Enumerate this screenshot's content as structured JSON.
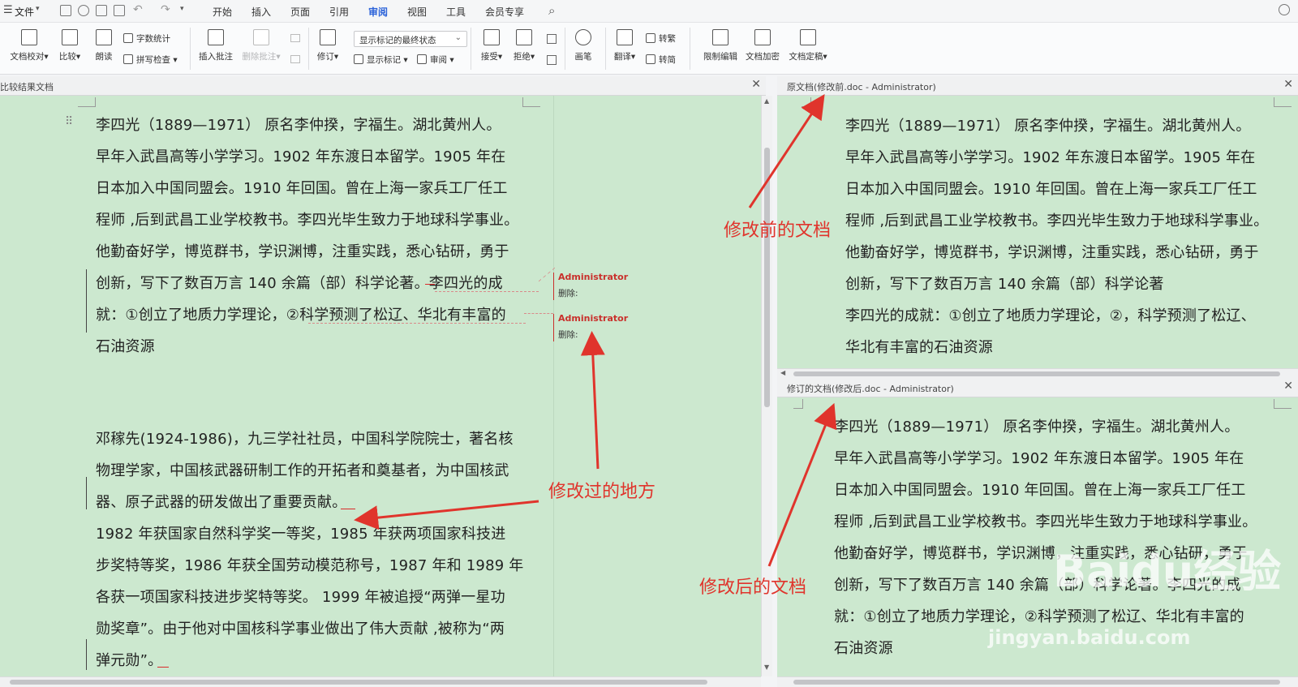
{
  "topbar": {
    "menu_icon": "hamburger-icon",
    "file_label": "文件",
    "tabs": [
      {
        "label": "开始",
        "active": false
      },
      {
        "label": "插入",
        "active": false
      },
      {
        "label": "页面",
        "active": false
      },
      {
        "label": "引用",
        "active": false
      },
      {
        "label": "审阅",
        "active": true
      },
      {
        "label": "视图",
        "active": false
      },
      {
        "label": "工具",
        "active": false
      },
      {
        "label": "会员专享",
        "active": false
      }
    ]
  },
  "ribbon": {
    "doc_proofread": "文档校对",
    "compare": "比较",
    "read_aloud": "朗读",
    "word_count": "字数统计",
    "spell_check": "拼写检查",
    "insert_comment": "插入批注",
    "delete_comment": "删除批注",
    "track_changes": "修订",
    "show_markup_state": "显示标记的最终状态",
    "show_markup": "显示标记",
    "review": "审阅",
    "accept": "接受",
    "reject": "拒绝",
    "pen": "画笔",
    "translate": "翻译",
    "to_traditional": "转繁",
    "to_simplified": "转简",
    "restrict_edit": "限制编辑",
    "doc_encrypt": "文档加密",
    "doc_finalize": "文档定稿"
  },
  "compare_pane": {
    "title": "比较结果文档",
    "paragraph1": [
      "李四光（1889—1971） 原名李仲揆，字福生。湖北黄州人。",
      "早年入武昌高等小学学习。1902 年东渡日本留学。1905 年在",
      "日本加入中国同盟会。1910 年回国。曾在上海一家兵工厂任工",
      "程师 ,后到武昌工业学校教书。李四光毕生致力于地球科学事业。",
      "他勤奋好学，博览群书，学识渊博，注重实践，悉心钻研，勇于",
      "创新，写下了数百万言 140 余篇（部）科学论著。李四光的成",
      "就：①创立了地质力学理论，②科学预测了松辽、华北有丰富的",
      "石油资源"
    ],
    "paragraph2": [
      "邓稼先(1924-1986)，九三学社社员，中国科学院院士，著名核",
      "物理学家，中国核武器研制工作的开拓者和奠基者，为中国核武",
      "器、原子武器的研发做出了重要贡献。",
      "1982 年获国家自然科学奖一等奖，1985 年获两项国家科技进",
      "步奖特等奖，1986 年获全国劳动模范称号，1987 年和 1989 年",
      "各获一项国家科技进步奖特等奖。 1999 年被追授“两弹一星功",
      "勋奖章”。由于他对中国核科学事业做出了伟大贡献 ,被称为“两",
      "弹元勋”。"
    ],
    "comments": [
      {
        "author": "Administrator",
        "text": "删除:"
      },
      {
        "author": "Administrator",
        "text": "删除:"
      }
    ]
  },
  "original_pane": {
    "title": "原文档(修改前.doc - Administrator)",
    "lines": [
      "李四光（1889—1971） 原名李仲揆，字福生。湖北黄州人。",
      "早年入武昌高等小学学习。1902 年东渡日本留学。1905 年在",
      "日本加入中国同盟会。1910 年回国。曾在上海一家兵工厂任工",
      "程师 ,后到武昌工业学校教书。李四光毕生致力于地球科学事业。",
      "他勤奋好学，博览群书，学识渊博，注重实践，悉心钻研，勇于",
      "创新，写下了数百万言 140 余篇（部）科学论著",
      "李四光的成就：①创立了地质力学理论，②，科学预测了松辽、",
      "华北有丰富的石油资源"
    ]
  },
  "revised_pane": {
    "title": "修订的文档(修改后.doc - Administrator)",
    "lines": [
      "李四光（1889—1971） 原名李仲揆，字福生。湖北黄州人。",
      "早年入武昌高等小学学习。1902 年东渡日本留学。1905 年在",
      "日本加入中国同盟会。1910 年回国。曾在上海一家兵工厂任工",
      "程师 ,后到武昌工业学校教书。李四光毕生致力于地球科学事业。",
      "他勤奋好学，博览群书，学识渊博，注重实践，悉心钻研，勇于",
      "创新，写下了数百万言 140 余篇（部）科学论著。李四光的成",
      "就：①创立了地质力学理论，②科学预测了松辽、华北有丰富的",
      "石油资源"
    ]
  },
  "annotations": {
    "before_doc": "修改前的文档",
    "changed_places": "修改过的地方",
    "after_doc": "修改后的文档",
    "accent_color": "#e0342c"
  },
  "watermark": {
    "brand": "Baidu经验",
    "url": "jingyan.baidu.com"
  }
}
